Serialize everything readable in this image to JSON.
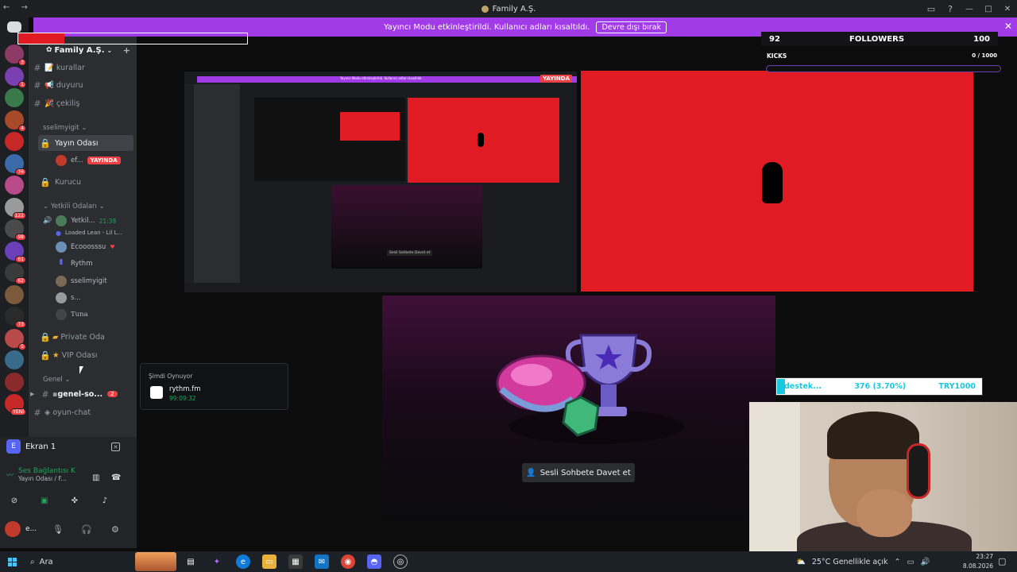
{
  "window": {
    "title": "Family A.Ş."
  },
  "notice": {
    "text": "Yayıncı Modu etkinleştirildi. Kullanıcı adları kısaltıldı.",
    "button": "Devre dışı bırak"
  },
  "server": {
    "name": "Family A.Ş."
  },
  "server_badges": [
    "3",
    "1",
    "",
    "4",
    "",
    "76",
    "",
    "122",
    "98",
    "61",
    "62",
    "",
    "73",
    "5",
    "",
    "",
    "YENİ"
  ],
  "channels": [
    {
      "type": "text",
      "name": "kurallar",
      "emoji": "📝"
    },
    {
      "type": "text",
      "name": "duyuru",
      "emoji": "📢"
    },
    {
      "type": "text",
      "name": "çekiliş",
      "emoji": "🎉"
    }
  ],
  "categories": {
    "c1": "sselimyigit",
    "c2": "Yetkili Odaları",
    "c3": "Genel"
  },
  "voice": {
    "yayin": "Yayın Odası",
    "yayin_user": "ef...",
    "live": "YAYINDA",
    "kurucu": "Kurucu",
    "yetkili_name": "Yetkil...",
    "yetkili_time": "21:39",
    "loaded": "Loaded Lean - Lil L...",
    "users": [
      "Ecooosssu",
      "Rythm",
      "sselimyigit",
      "s...",
      "Tuna"
    ],
    "private": "Private Oda",
    "vip": "VIP Odası"
  },
  "text2": {
    "genel": "genel-so...",
    "genel_badge": "2",
    "oyun": "oyun-chat"
  },
  "popup": {
    "title": "Şimdi Oynuyor",
    "game": "rythm.fm",
    "time": "99:09:32"
  },
  "userpanel": {
    "screen": "Ekran 1",
    "voice_status": "Ses Bağlantısı K",
    "voice_sub": "Yayın Odası / F...",
    "me": "e..."
  },
  "stream": {
    "mini_live": "YAYINDA",
    "mini_notice": "Yayıncı Modu etkinleştirildi. Kullanıcı adları kısaltıldı.",
    "mini_button": "Sesli Sohbete Davet et"
  },
  "overlay": {
    "followers_left": "92",
    "followers_label": "FOLLOWERS",
    "followers_right": "100",
    "kicks_label": "KICKS",
    "kicks_value": "0 / 1000",
    "kicks_progress": 0.0,
    "donate_label": "destek...",
    "donate_value": "376 (3.70%)",
    "donate_goal": "TRY1000",
    "donate_progress": 0.037
  },
  "invite": "Sesli Sohbete Davet et",
  "taskbar": {
    "search": "Ara",
    "weather": "25°C Genellikle açık",
    "time": "23:27",
    "date": "8.08.2026"
  },
  "colors": {
    "accent": "#a13be8",
    "red": "#e01b24",
    "live": "#ed4245",
    "green": "#23a55a",
    "sidebar": "#2b2d31"
  }
}
